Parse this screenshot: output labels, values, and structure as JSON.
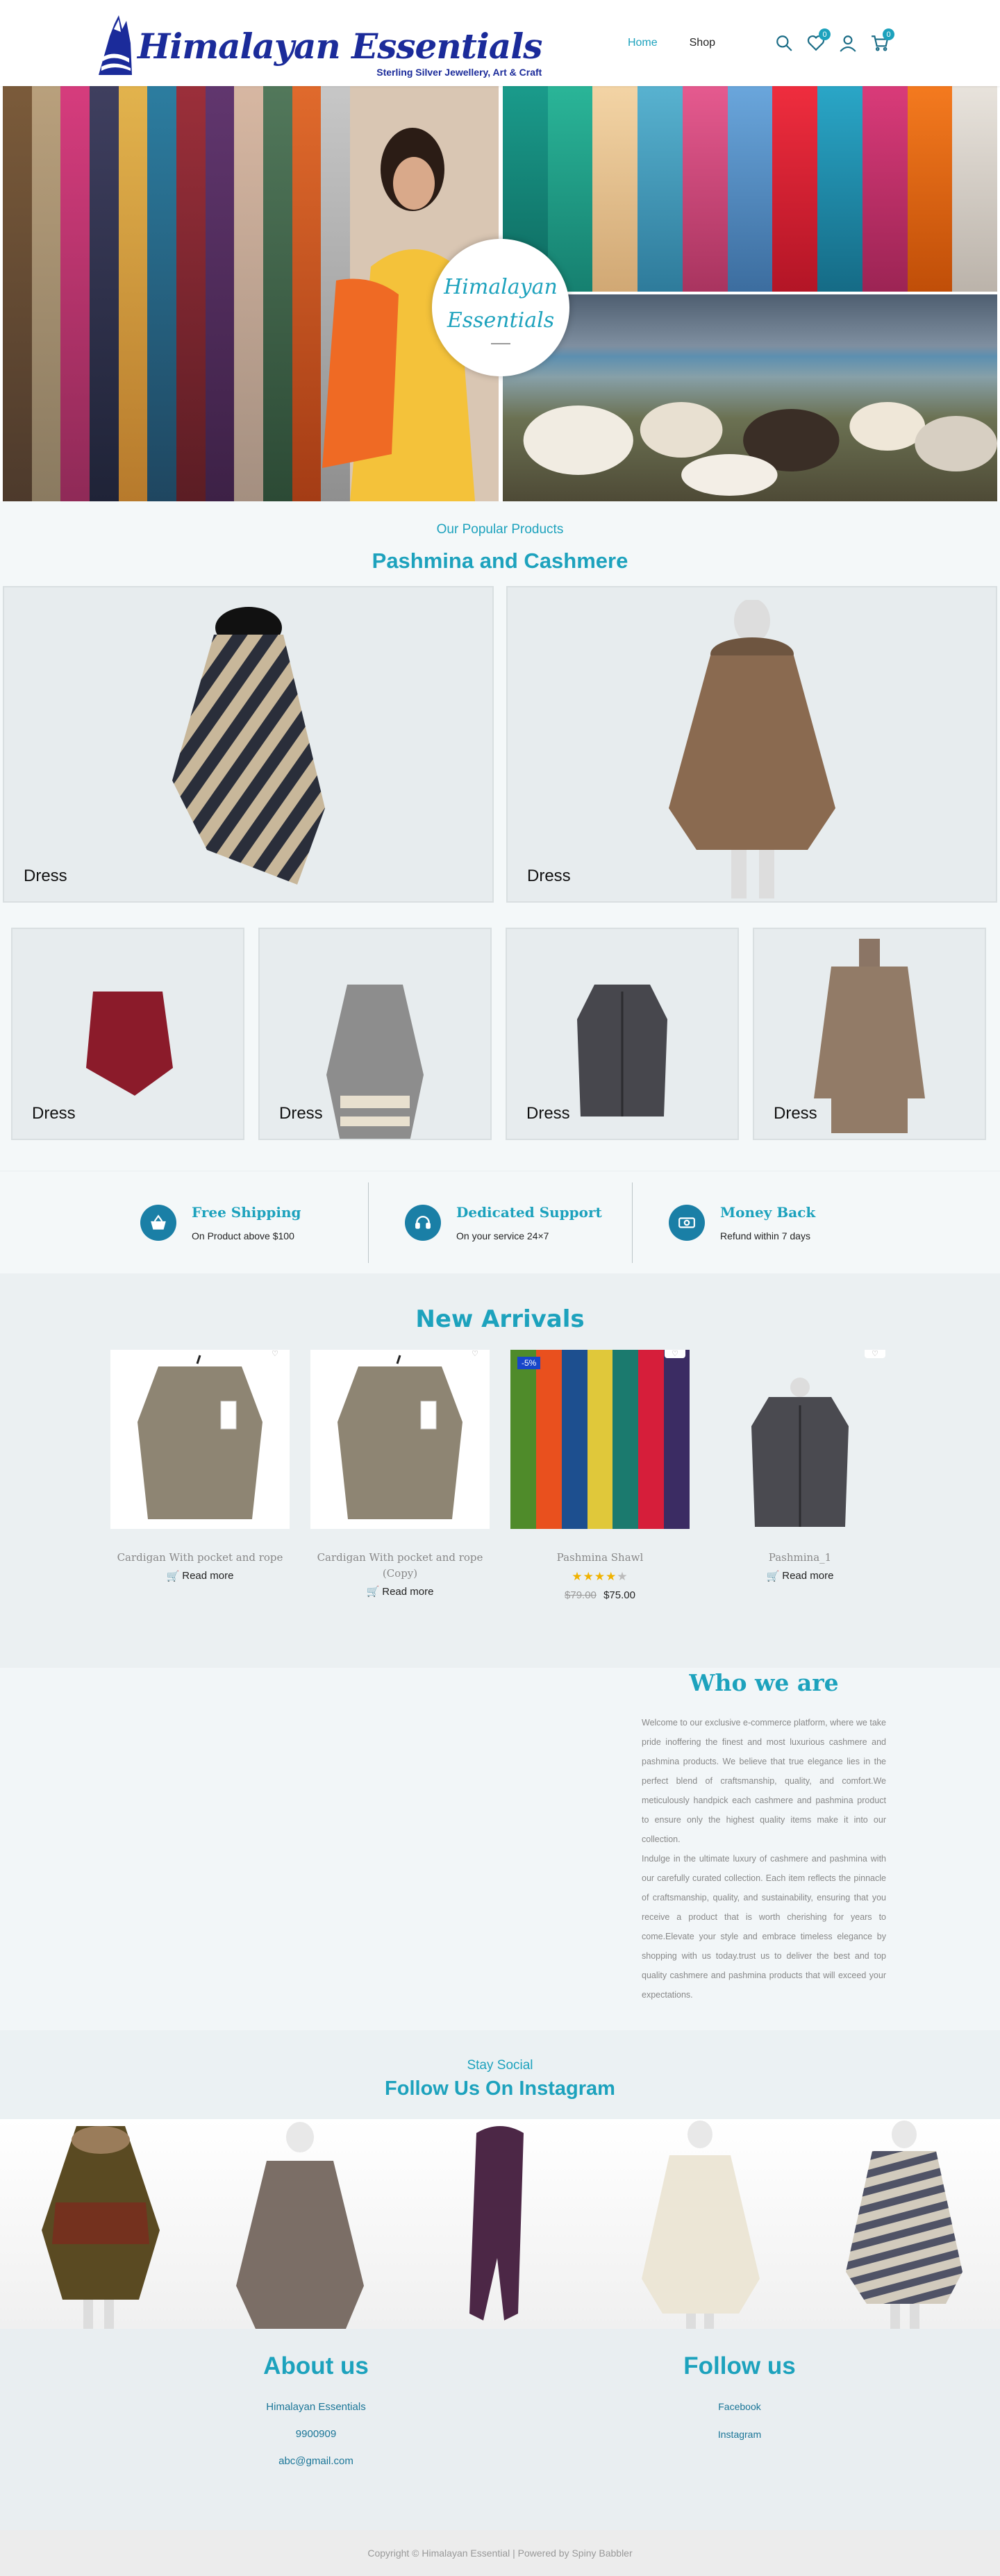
{
  "brand": {
    "title": "Himalayan Essentials",
    "subtitle": "Sterling Silver Jewellery, Art & Craft"
  },
  "nav": {
    "items": [
      {
        "label": "Home",
        "active": true
      },
      {
        "label": "Shop",
        "active": false
      }
    ],
    "wishlist_count": "0",
    "cart_count": "0"
  },
  "hero": {
    "circle_line1": "Himalayan",
    "circle_line2": "Essentials"
  },
  "popular": {
    "subtitle": "Our Popular Products",
    "title": "Pashmina and Cashmere",
    "big_cards": [
      {
        "label": "Dress"
      },
      {
        "label": "Dress"
      }
    ],
    "small_cards": [
      {
        "label": "Dress"
      },
      {
        "label": "Dress"
      },
      {
        "label": "Dress"
      },
      {
        "label": "Dress"
      }
    ]
  },
  "features": [
    {
      "title": "Free Shipping",
      "desc": "On Product above $100",
      "icon": "basket-icon"
    },
    {
      "title": "Dedicated Support",
      "desc": "On your service 24×7",
      "icon": "headset-icon"
    },
    {
      "title": "Money Back",
      "desc": "Refund within 7 days",
      "icon": "cash-icon"
    }
  ],
  "arrivals": {
    "title": "New Arrivals",
    "items": [
      {
        "name": "Cardigan With pocket and rope",
        "button": "Read more"
      },
      {
        "name": "Cardigan With pocket and rope (Copy)",
        "button": "Read more"
      },
      {
        "name": "Pashmina Shawl",
        "sale": "-5%",
        "rating": 4,
        "old_price": "$79.00",
        "new_price": "$75.00"
      },
      {
        "name": "Pashmina_1",
        "button": "Read more"
      }
    ]
  },
  "who": {
    "title": "Who we are",
    "p1": "Welcome to our exclusive e-commerce platform, where we take pride inoffering the finest and most luxurious cashmere and pashmina products. We believe that true elegance lies in the perfect blend of craftsmanship, quality, and comfort.We meticulously handpick each cashmere and pashmina product to ensure only the highest quality items make it into our collection.",
    "p2": "Indulge in the ultimate luxury of cashmere and pashmina with our carefully curated collection. Each item reflects the pinnacle of craftsmanship, quality, and sustainability, ensuring that you receive a product that is worth cherishing for years to come.Elevate your style and embrace timeless elegance by shopping with us today.trust us to deliver the best and top quality cashmere and pashmina products that will exceed your expectations."
  },
  "instagram": {
    "subtitle": "Stay Social",
    "title": "Follow Us On Instagram"
  },
  "footer": {
    "about_title": "About us",
    "about_lines": [
      "Himalayan Essentials",
      "9900909",
      "abc@gmail.com"
    ],
    "follow_title": "Follow us",
    "follow_links": [
      "Facebook",
      "Instagram"
    ],
    "copyright": "Copyright © Himalayan Essential | Powered by Spiny Babbler"
  },
  "colors": {
    "accent": "#1da2bd",
    "brand": "#1b2b9a",
    "icon_bg": "#1a7fa6"
  }
}
